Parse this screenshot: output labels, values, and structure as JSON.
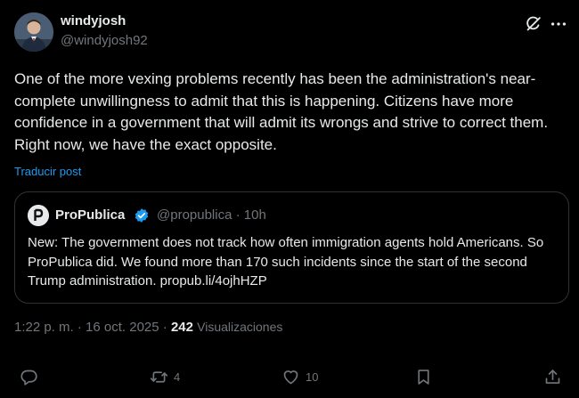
{
  "post": {
    "author": {
      "name": "windyjosh",
      "handle": "@windyjosh92"
    },
    "text": "One of the more vexing problems recently has been the administration's near-complete unwillingness to admit that this is happening. Citizens have more confidence in a government that will admit its wrongs and strive to correct them. Right now, we have the exact opposite.",
    "translate_label": "Traducir post",
    "timestamp": "1:22 p. m. · 16 oct. 2025 · ",
    "views_count": "242",
    "views_label": "Visualizaciones"
  },
  "quote": {
    "name": "ProPublica",
    "meta": "@propublica · 10h",
    "text": "New: The government does not track how often immigration agents hold Americans. So ProPublica did. We found more than 170 such incidents since the start of the second Trump administration. propub.li/4ojhHZP"
  },
  "actions": {
    "reposts": "4",
    "likes": "10"
  },
  "icons": {
    "grok": "grok-icon",
    "more": "more-icon",
    "verified": "verified-badge-icon",
    "reply": "reply-icon",
    "repost": "repost-icon",
    "like": "heart-icon",
    "bookmark": "bookmark-icon",
    "share": "share-icon"
  },
  "colors": {
    "background": "#000000",
    "text": "#e7e9ea",
    "secondary": "#71767b",
    "link": "#1d9bf0",
    "border": "#2f3336",
    "verified": "#1d9bf0"
  }
}
